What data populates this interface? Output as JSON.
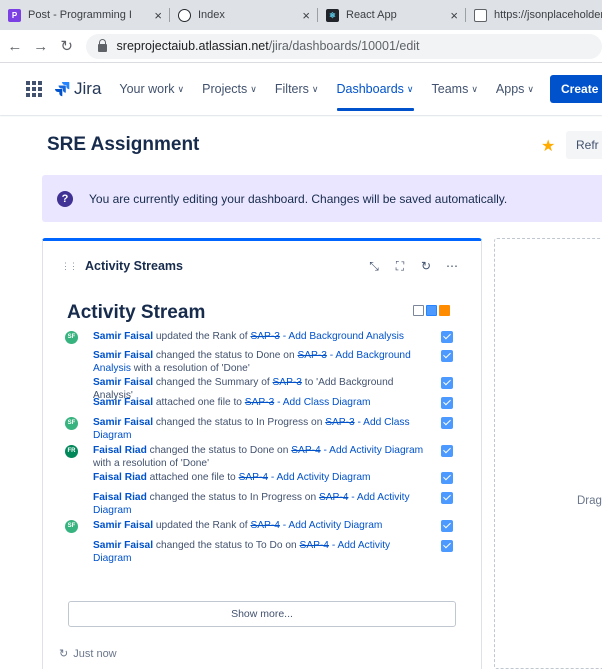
{
  "browser": {
    "tabs": [
      {
        "label": "Post - Programming I",
        "color": "#7b3fe4",
        "icon": "P"
      },
      {
        "label": "Index",
        "color": "#24292e",
        "icon": ""
      },
      {
        "label": "React App",
        "color": "#20232a",
        "icon": ""
      },
      {
        "label": "https://jsonplaceholder",
        "color": "#ffffff",
        "icon": ""
      }
    ],
    "url_host": "sreprojectaiub.atlassian.net",
    "url_path": "/jira/dashboards/10001/edit"
  },
  "nav": {
    "logo_text": "Jira",
    "items": [
      {
        "label": "Your work",
        "active": false
      },
      {
        "label": "Projects",
        "active": false
      },
      {
        "label": "Filters",
        "active": false
      },
      {
        "label": "Dashboards",
        "active": true
      },
      {
        "label": "Teams",
        "active": false
      },
      {
        "label": "Apps",
        "active": false
      }
    ],
    "create_label": "Create"
  },
  "page": {
    "title": "SRE Assignment",
    "refresh_label": "Refr"
  },
  "banner": {
    "text": "You are currently editing your dashboard. Changes will be saved automatically."
  },
  "gadget": {
    "title": "Activity Streams",
    "stream_title": "Activity Stream",
    "show_more": "Show more...",
    "updated": "Just now"
  },
  "entries": [
    {
      "avatar": "SF",
      "user": "Samir Faisal",
      "pre": " updated the Rank of ",
      "issue": "SAP-3",
      "link": " - Add Background Analysis",
      "post": ""
    },
    {
      "avatar": "",
      "user": "Samir Faisal",
      "pre": " changed the status to Done on ",
      "issue": "SAP-3",
      "link": " - Add Background Analysis",
      "post": " with a resolution of 'Done'"
    },
    {
      "avatar": "",
      "user": "Samir Faisal",
      "pre": " changed the Summary of ",
      "issue": "SAP-3",
      "link": "",
      "post": " to 'Add Background Analysis'"
    },
    {
      "avatar": "",
      "user": "Samir Faisal",
      "pre": " attached one file to ",
      "issue": "SAP-3",
      "link": " - Add Class Diagram",
      "post": ""
    },
    {
      "avatar": "SF",
      "user": "Samir Faisal",
      "pre": " changed the status to In Progress on ",
      "issue": "SAP-3",
      "link": " - Add Class Diagram",
      "post": ""
    },
    {
      "avatar": "FR",
      "user": "Faisal Riad",
      "pre": " changed the status to Done on ",
      "issue": "SAP-4",
      "link": " - Add Activity Diagram",
      "post": " with a resolution of 'Done'"
    },
    {
      "avatar": "",
      "user": "Faisal Riad",
      "pre": " attached one file to ",
      "issue": "SAP-4",
      "link": " - Add Activity Diagram",
      "post": ""
    },
    {
      "avatar": "",
      "user": "Faisal Riad",
      "pre": " changed the status to In Progress on ",
      "issue": "SAP-4",
      "link": " - Add Activity Diagram",
      "post": ""
    },
    {
      "avatar": "SF",
      "user": "Samir Faisal",
      "pre": " updated the Rank of ",
      "issue": "SAP-4",
      "link": " - Add Activity Diagram",
      "post": ""
    },
    {
      "avatar": "",
      "user": "Samir Faisal",
      "pre": " changed the status to To Do on ",
      "issue": "SAP-4",
      "link": " - Add Activity Diagram",
      "post": ""
    }
  ],
  "drop_area": {
    "text": "Drag"
  }
}
